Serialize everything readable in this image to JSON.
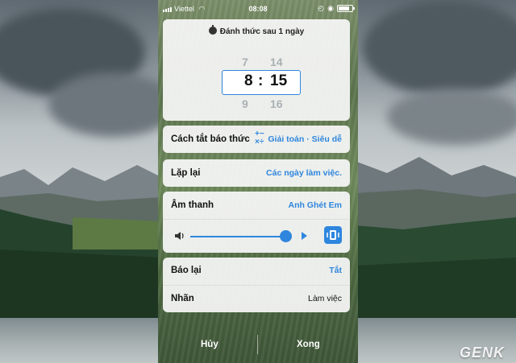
{
  "status_bar": {
    "carrier": "Viettel",
    "time": "08:08"
  },
  "alarm": {
    "wake_note": "Đánh thức sau 1 ngày",
    "hour_above": "7",
    "hour_selected": "8",
    "hour_below": "9",
    "separator": ":",
    "minute_above": "14",
    "minute_selected": "15",
    "minute_below": "16"
  },
  "settings": {
    "dismiss_method": {
      "label": "Cách tắt báo thức",
      "value": "Giải toán · Siêu dễ",
      "icon": "math-icon"
    },
    "repeat": {
      "label": "Lặp lại",
      "value": "Các ngày làm việc."
    },
    "sound": {
      "label": "Âm thanh",
      "value": "Anh Ghét Em"
    },
    "volume": {
      "level": 0.95
    },
    "snooze": {
      "label": "Báo lại",
      "value": "Tắt"
    },
    "tag": {
      "label": "Nhãn",
      "value": "Làm việc"
    }
  },
  "actions": {
    "cancel": "Hủy",
    "done": "Xong"
  },
  "watermark": {
    "brand": "GENK"
  },
  "colors": {
    "accent": "#2e86de",
    "card": "#f8f8f8"
  }
}
